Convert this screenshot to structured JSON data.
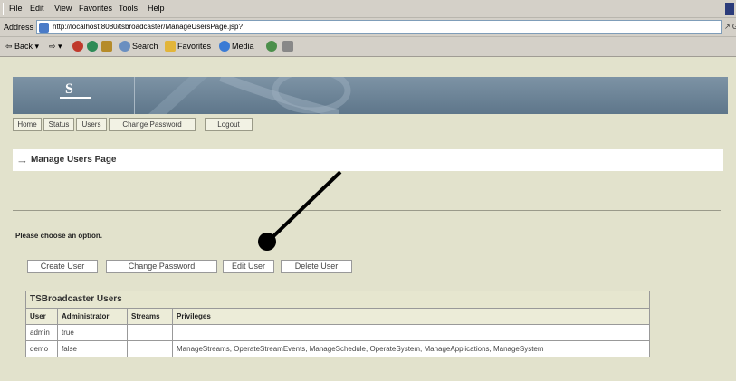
{
  "menubar": {
    "items": [
      "File",
      "Edit",
      "View",
      "Favorites",
      "Tools",
      "Help"
    ]
  },
  "address": {
    "label": "Address",
    "url": "http://localhost:8080/tsbroadcaster/ManageUsersPage.jsp?",
    "go_label": "↗ G"
  },
  "toolbar": {
    "back": "⇦ Back ▾",
    "forward": "⇨ ▾",
    "search": "Search",
    "favorites": "Favorites",
    "media": "Media"
  },
  "banner": {
    "logo": "S"
  },
  "nav": {
    "items": [
      "Home",
      "Status",
      "Users",
      "Change Password",
      "Logout"
    ]
  },
  "page": {
    "title": "Manage Users Page",
    "title_arrow": "→",
    "choose": "Please choose an option."
  },
  "options": [
    "Create User",
    "Change Password",
    "Edit User",
    "Delete User"
  ],
  "users_table": {
    "title": "TSBroadcaster Users",
    "headers": [
      "User",
      "Administrator",
      "Streams",
      "Privileges"
    ],
    "rows": [
      [
        "admin",
        "true",
        "",
        ""
      ],
      [
        "demo",
        "false",
        "",
        "ManageStreams, OperateStreamEvents, ManageSchedule, OperateSystem, ManageApplications, ManageSystem"
      ]
    ]
  },
  "colors": {
    "chrome": "#d4d0c8",
    "page_bg": "#e2e2cc",
    "banner": "#6b8396"
  }
}
